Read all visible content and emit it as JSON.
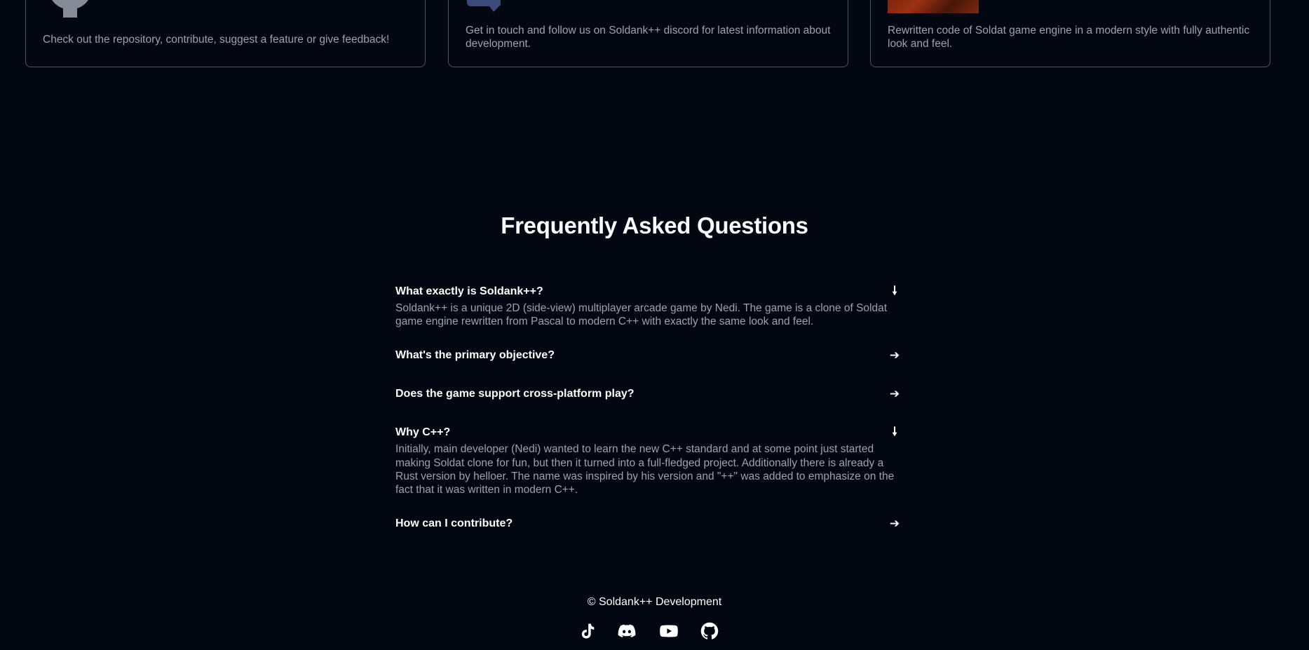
{
  "cards": [
    {
      "logo": "github-logo",
      "description": "Check out the repository, contribute, suggest a feature or give feedback!"
    },
    {
      "logo": "discord-logo",
      "description": "Get in touch and follow us on Soldank++ discord for latest information about development."
    },
    {
      "logo": "soldat-logo",
      "description": "Rewritten code of Soldat game engine in a modern style with fully authentic look and feel."
    }
  ],
  "faq": {
    "title": "Frequently Asked Questions",
    "items": [
      {
        "question": "What exactly is Soldank++?",
        "expanded": true,
        "arrow": "🠗",
        "answer": "Soldank++ is a unique 2D (side-view) multiplayer arcade game by Nedi. The game is a clone of Soldat game engine rewritten from Pascal to modern C++ with exactly the same look and feel."
      },
      {
        "question": "What's the primary objective?",
        "expanded": false,
        "arrow": "➔"
      },
      {
        "question": "Does the game support cross-platform play?",
        "expanded": false,
        "arrow": "➔"
      },
      {
        "question": "Why C++?",
        "expanded": true,
        "arrow": "🠗",
        "answer": "Initially, main developer (Nedi) wanted to learn the new C++ standard and at some point just started making Soldat clone for fun, but then it turned into a full-fledged project. Additionally there is already a Rust version by helloer. The name was inspired by his version and \"++\" was added to emphasize on the fact that it was written in modern C++."
      },
      {
        "question": "How can I contribute?",
        "expanded": false,
        "arrow": "➔"
      }
    ]
  },
  "footer": {
    "copyright": "© Soldank++ Development",
    "socials": [
      "tiktok-icon",
      "discord-icon",
      "youtube-icon",
      "github-icon"
    ]
  },
  "colors": {
    "background": "#030712",
    "card_border": "#4b5563",
    "muted_text": "#9ca3af",
    "heading": "#f9fafb"
  }
}
